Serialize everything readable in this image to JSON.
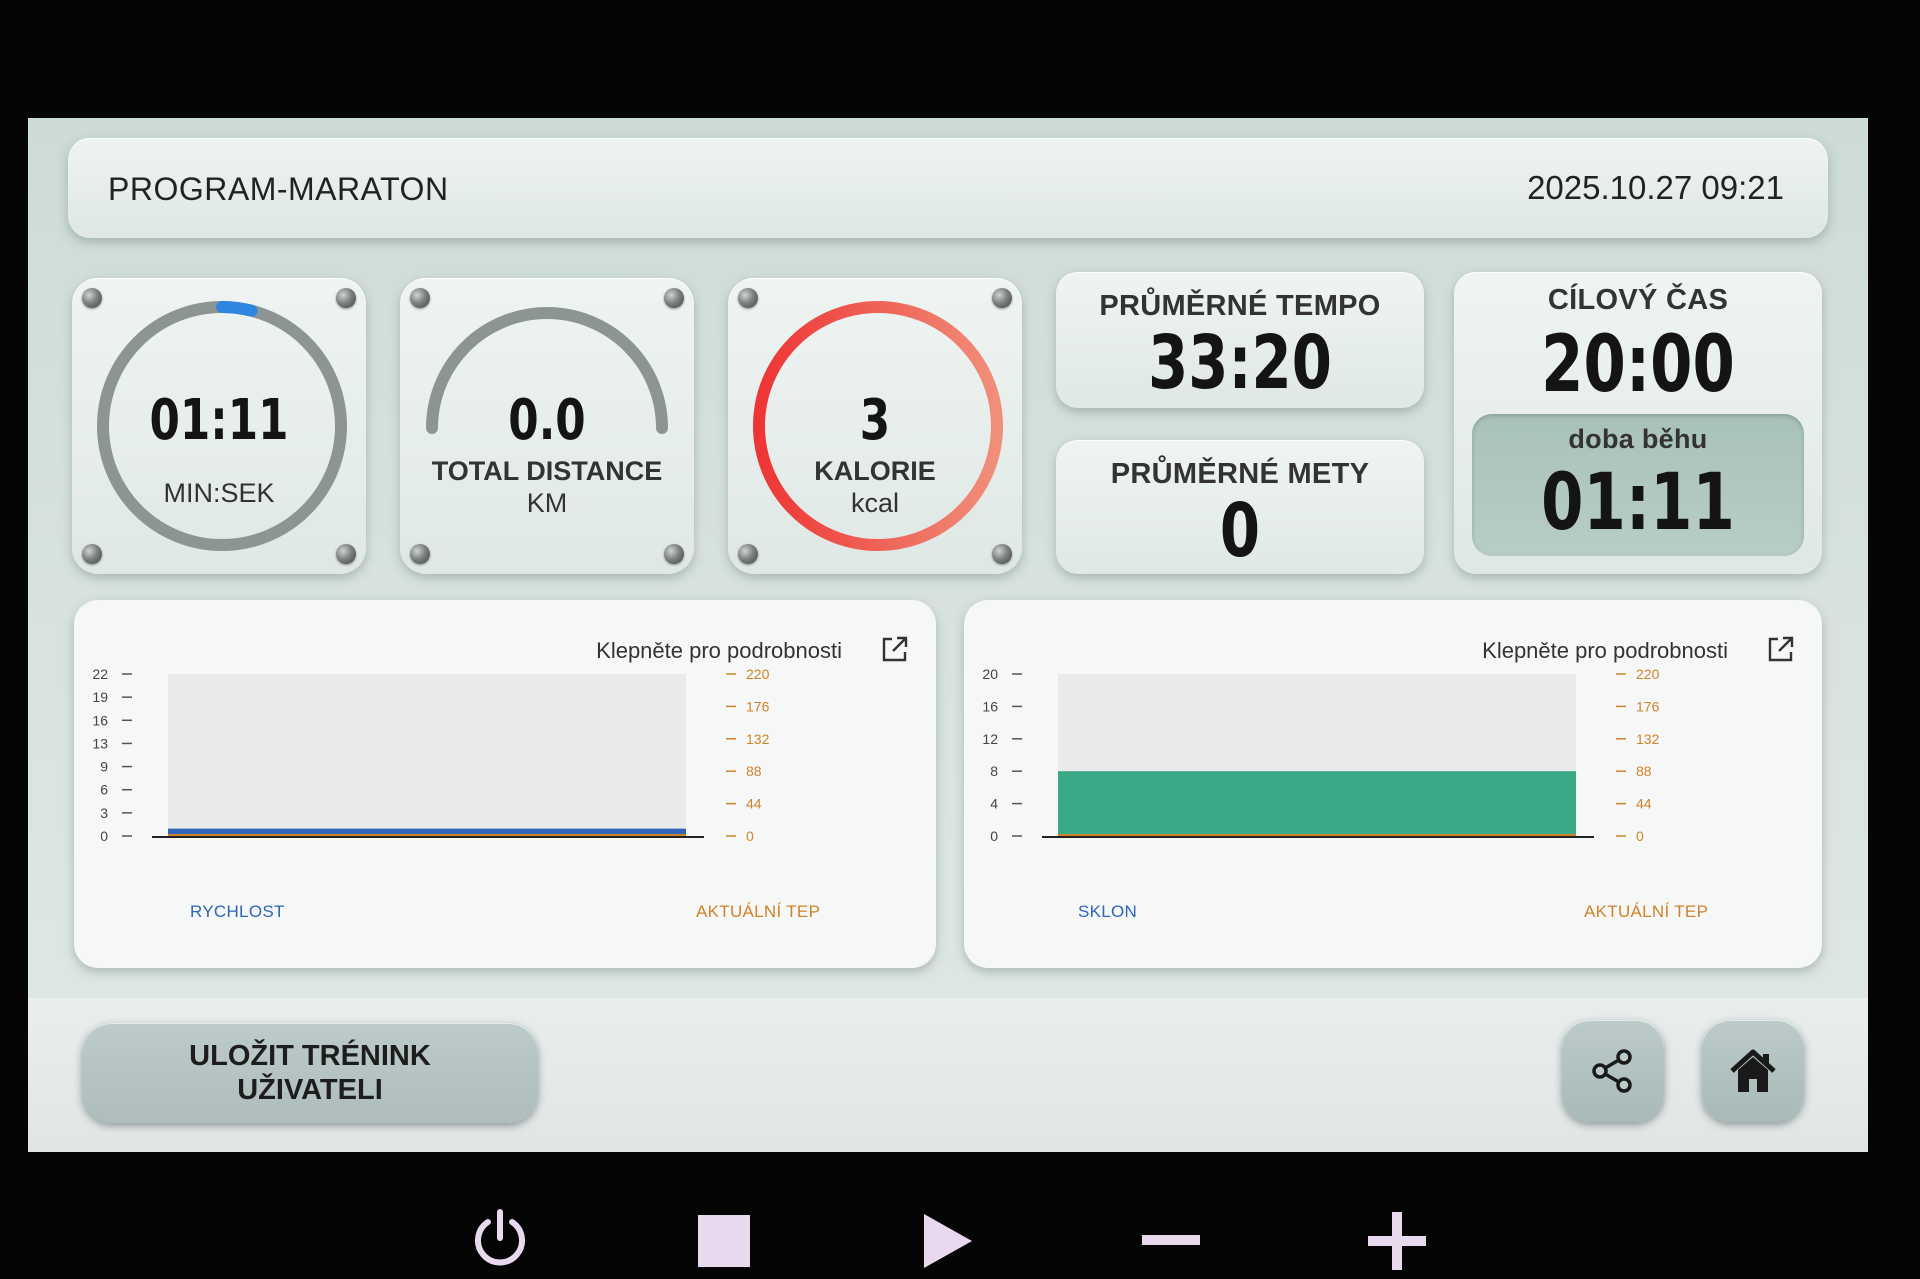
{
  "header": {
    "program_name": "PROGRAM-MARATON",
    "datetime": "2025.10.27 09:21"
  },
  "gauges": {
    "time": {
      "value": "01:11",
      "unit": "MIN:SEK",
      "progress": 0.04,
      "accent": "#2f86e0"
    },
    "distance": {
      "value": "0.0",
      "label": "TOTAL DISTANCE",
      "unit": "KM",
      "progress": 0
    },
    "calories": {
      "value": "3",
      "label": "KALORIE",
      "unit": "kcal",
      "accent": "#ef3b3b"
    }
  },
  "stats": {
    "avg_tempo": {
      "label": "PRŮMĚRNÉ TEMPO",
      "value": "33:20"
    },
    "avg_mets": {
      "label": "PRŮMĚRNÉ METY",
      "value": "0"
    },
    "target_time": {
      "label": "CÍLOVÝ ČAS",
      "value": "20:00"
    },
    "run_time": {
      "label": "doba běhu",
      "value": "01:11"
    }
  },
  "charts": {
    "link_text": "Klepněte pro podrobnosti",
    "speed": {
      "left_label": "RYCHLOST",
      "right_label": "AKTUÁLNÍ TEP",
      "left_ticks": [
        "22",
        "19",
        "16",
        "13",
        "9",
        "6",
        "3",
        "0"
      ],
      "right_ticks": [
        "220",
        "176",
        "132",
        "88",
        "44",
        "0"
      ],
      "left_color": "#2f64b8",
      "right_color": "#d0822a"
    },
    "incline": {
      "left_label": "SKLON",
      "right_label": "AKTUÁLNÍ TEP",
      "left_ticks": [
        "20",
        "16",
        "12",
        "8",
        "4",
        "0"
      ],
      "right_ticks": [
        "220",
        "176",
        "132",
        "88",
        "44",
        "0"
      ],
      "left_color": "#2f64b8",
      "right_color": "#d0822a",
      "fill_color": "#3aa987"
    }
  },
  "chart_data": [
    {
      "type": "area",
      "title": "",
      "xlabel": "",
      "ylabel": "RYCHLOST",
      "ylim": [
        0,
        22
      ],
      "y2label": "AKTUÁLNÍ TEP",
      "y2lim": [
        0,
        220
      ],
      "series": [
        {
          "name": "RYCHLOST",
          "values": [
            1,
            1
          ],
          "color": "#2f64b8"
        },
        {
          "name": "AKTUÁLNÍ TEP",
          "values": [
            0,
            0
          ],
          "color": "#d0822a"
        }
      ]
    },
    {
      "type": "area",
      "title": "",
      "xlabel": "",
      "ylabel": "SKLON",
      "ylim": [
        0,
        20
      ],
      "y2label": "AKTUÁLNÍ TEP",
      "y2lim": [
        0,
        220
      ],
      "series": [
        {
          "name": "SKLON",
          "values": [
            8,
            8
          ],
          "color": "#3aa987"
        },
        {
          "name": "AKTUÁLNÍ TEP",
          "values": [
            0,
            0
          ],
          "color": "#d0822a"
        }
      ]
    }
  ],
  "footer": {
    "save_line1": "ULOŽIT TRÉNINK",
    "save_line2": "UŽIVATELI"
  },
  "icons": {
    "link": "external-link-icon",
    "share": "share-icon",
    "home": "home-icon",
    "power": "power-icon",
    "stop": "stop-icon",
    "play": "play-icon",
    "minus": "minus-icon",
    "plus": "plus-icon"
  }
}
